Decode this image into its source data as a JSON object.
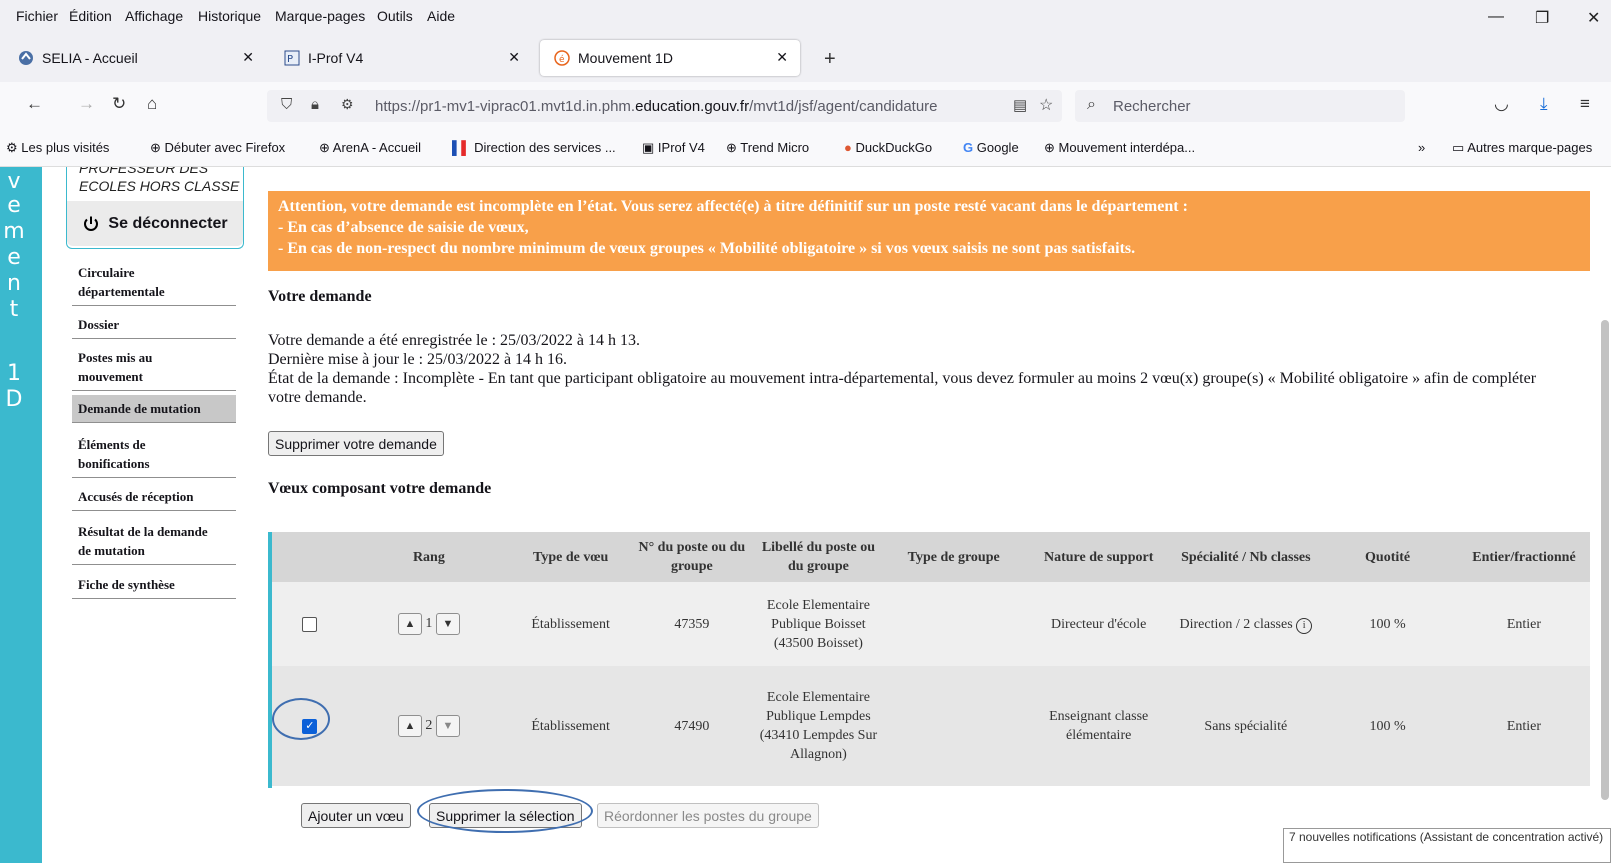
{
  "menu": [
    "Fichier",
    "Édition",
    "Affichage",
    "Historique",
    "Marque-pages",
    "Outils",
    "Aide"
  ],
  "tabs": [
    {
      "title": "SELIA - Accueil",
      "icon": "selia-icon"
    },
    {
      "title": "I-Prof V4",
      "icon": "iprof-icon"
    },
    {
      "title": "Mouvement 1D",
      "icon": "mouvement-icon"
    }
  ],
  "url": {
    "prefix": "https://pr1-mv1-viprac01.mvt1d.in.phm.",
    "domain": "education.gouv.fr",
    "path": "/mvt1d/jsf/agent/candidature"
  },
  "search": {
    "placeholder": "Rechercher"
  },
  "bookmarks": [
    "Les plus visités",
    "Débuter avec Firefox",
    "ArenA - Accueil",
    "Direction des services ...",
    "IProf V4",
    "Trend Micro",
    "DuckDuckGo",
    "Google",
    "Mouvement interdépa...",
    "Autres marque-pages"
  ],
  "stripe": [
    "v",
    "e",
    "m",
    "e",
    "n",
    "t",
    "1",
    "D"
  ],
  "user": {
    "role_line1": "PROFESSEUR DES",
    "role_line2": "ECOLES HORS CLASSE",
    "logout": "Se déconnecter"
  },
  "nav": [
    {
      "l1": "Circulaire",
      "l2": "départementale"
    },
    {
      "l1": "Dossier",
      "l2": ""
    },
    {
      "l1": "Postes mis au",
      "l2": "mouvement"
    },
    {
      "l1": "Demande de mutation",
      "l2": ""
    },
    {
      "l1": "Éléments de",
      "l2": "bonifications"
    },
    {
      "l1": "Accusés de réception",
      "l2": ""
    },
    {
      "l1": "Résultat de la demande",
      "l2": "de mutation"
    },
    {
      "l1": "Fiche de synthèse",
      "l2": ""
    }
  ],
  "alert": [
    "Attention, votre demande est incomplète en l’état. Vous serez affecté(e) à titre définitif sur un poste resté vacant dans le département :",
    "- En cas d’absence de saisie de vœux,",
    "- En cas de non-respect du nombre minimum de vœux groupes « Mobilité obligatoire » si vos vœux saisis ne sont pas satisfaits."
  ],
  "demande": {
    "title": "Votre demande",
    "line1": "Votre demande a été enregistrée le : 25/03/2022 à 14 h 13.",
    "line2": "Dernière mise à jour le : 25/03/2022 à 14 h 16.",
    "line3": "État de la demande : Incomplète - En tant que participant obligatoire au mouvement intra-départemental, vous devez formuler au moins 2 vœu(x) groupe(s) « Mobilité obligatoire » afin de compléter votre demande.",
    "delete_button": "Supprimer votre demande"
  },
  "voeux": {
    "title": "Vœux composant votre demande",
    "headers": [
      "",
      "Rang",
      "Type de vœu",
      "N° du poste ou du groupe",
      "Libellé du poste ou du groupe",
      "Type de groupe",
      "Nature de support",
      "Spécialité / Nb classes",
      "Quotité",
      "Entier/fractionné"
    ],
    "rows": [
      {
        "checked": false,
        "rang": "1",
        "type": "Établissement",
        "numero": "47359",
        "libelle": "Ecole Elementaire Publique Boisset (43500 Boisset)",
        "type_groupe": "",
        "nature": "Directeur d'école",
        "specialite": "Direction / 2 classes",
        "quotite": "100 %",
        "entier": "Entier"
      },
      {
        "checked": true,
        "rang": "2",
        "type": "Établissement",
        "numero": "47490",
        "libelle": "Ecole Elementaire Publique Lempdes (43410 Lempdes Sur Allagnon)",
        "type_groupe": "",
        "nature": "Enseignant classe élémentaire",
        "specialite": "Sans spécialité",
        "quotite": "100 %",
        "entier": "Entier"
      }
    ]
  },
  "actions": {
    "add": "Ajouter un vœu",
    "delete_sel": "Supprimer la sélection",
    "reorder": "Réordonner les postes du groupe"
  },
  "toast": "7 nouvelles notifications (Assistant de concentration activé)"
}
